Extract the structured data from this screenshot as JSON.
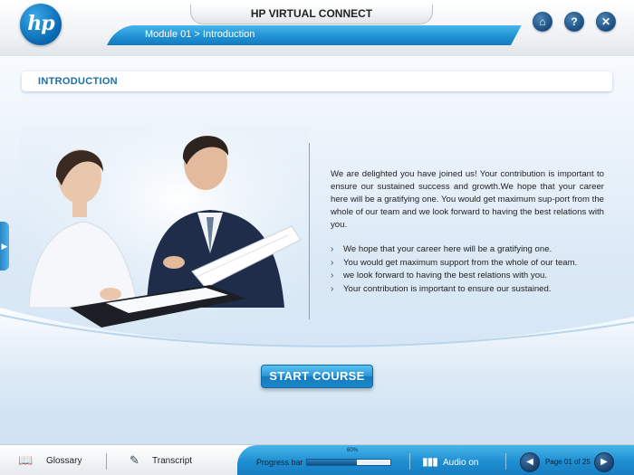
{
  "app": {
    "logo_text": "hp",
    "title": "HP VIRTUAL CONNECT",
    "breadcrumb": "Module 01 > Introduction"
  },
  "header_buttons": [
    {
      "icon": "home-icon",
      "glyph": "⌂"
    },
    {
      "icon": "help-icon",
      "glyph": "?"
    },
    {
      "icon": "close-icon",
      "glyph": "✕"
    }
  ],
  "section": {
    "heading": "INTRODUCTION"
  },
  "content": {
    "paragraph": "We are delighted you have joined us! Your contribution is important to ensure our sustained success and growth.We hope that your career here will be a gratifying one. You would get maximum sup-port from the whole of our team and we look forward to having the best relations with you.",
    "bullets": [
      "We hope that your career here will be a gratifying one.",
      "You would get maximum support from the whole of our team.",
      "we look forward to having the best relations with you.",
      "Your contribution is important to ensure our sustained."
    ],
    "bullet_glyph": "›"
  },
  "start_button": {
    "label": "START COURSE"
  },
  "footer": {
    "glossary_label": "Glossary",
    "transcript_label": "Transcript",
    "progress_label": "Progress bar",
    "progress_percent_label": "60%",
    "progress_value": 0.6,
    "audio_label": "Audio on",
    "page_label": "Page 01 of 25",
    "prev_glyph": "◀",
    "next_glyph": "▶"
  },
  "colors": {
    "accent": "#1e8fd2",
    "heading": "#1d6fa8",
    "button_dark": "#1d4f82"
  }
}
